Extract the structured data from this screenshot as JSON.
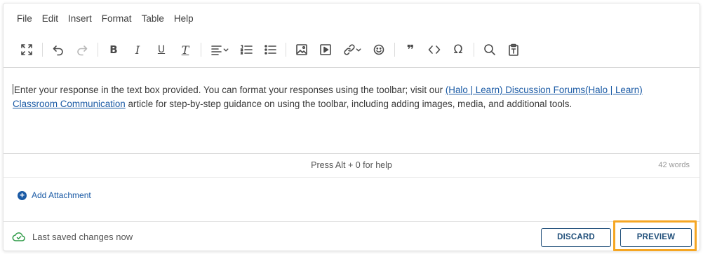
{
  "menu": [
    "File",
    "Edit",
    "Insert",
    "Format",
    "Table",
    "Help"
  ],
  "toolbar": {
    "icons": [
      "fullscreen-icon",
      "undo-icon",
      "redo-icon",
      "bold-icon",
      "italic-icon",
      "underline-icon",
      "clear-format-icon",
      "align-icon",
      "numbered-list-icon",
      "bullet-list-icon",
      "image-icon",
      "media-icon",
      "link-icon",
      "emoji-icon",
      "blockquote-icon",
      "code-icon",
      "special-char-icon",
      "search-icon",
      "paste-text-icon"
    ],
    "bold_label": "B",
    "italic_label": "I",
    "underline_label": "U",
    "clear_label": "T",
    "blockquote_label": "❞",
    "code_label": "<>",
    "omega_label": "Ω"
  },
  "editor": {
    "text_before": "Enter your response in the text box provided. You can format your responses using the toolbar; visit our ",
    "link_text": "(Halo | Learn) Discussion Forums(Halo | Learn) Classroom Communication",
    "text_after": " article for step-by-step guidance on using the toolbar, including adding images, media, and additional tools."
  },
  "status": {
    "help_text": "Press Alt + 0 for help",
    "word_count": "42 words"
  },
  "attachment": {
    "label": "Add Attachment"
  },
  "footer": {
    "saved_text": "Last saved changes now",
    "discard_label": "DISCARD",
    "preview_label": "PREVIEW"
  },
  "colors": {
    "link": "#1a5aa5",
    "button_border": "#1f4e79",
    "saved_green": "#2d9a46",
    "highlight": "#f5a623"
  }
}
